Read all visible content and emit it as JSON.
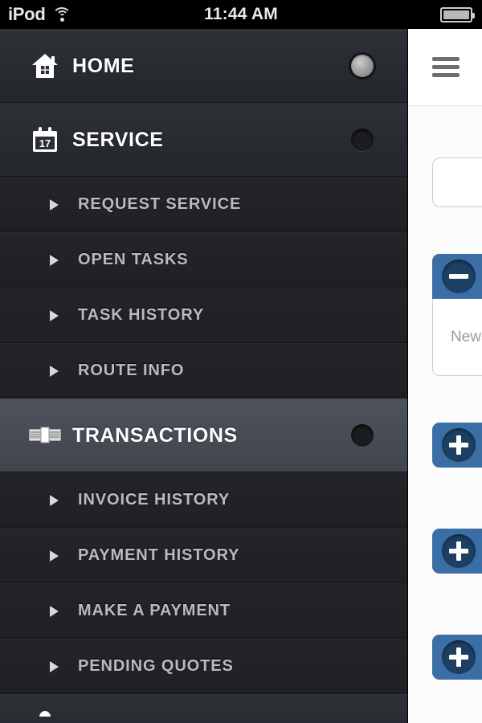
{
  "status_bar": {
    "carrier": "iPod",
    "wifi_icon": "wifi-icon",
    "time": "11:44 AM",
    "battery_icon": "battery-icon"
  },
  "sidebar": {
    "sections": [
      {
        "label": "HOME",
        "icon": "home-icon",
        "indicator": "on",
        "children": []
      },
      {
        "label": "SERVICE",
        "icon": "calendar-icon",
        "icon_day": "17",
        "indicator": "off",
        "children": [
          {
            "label": "REQUEST SERVICE",
            "icon": "triangle-right-icon"
          },
          {
            "label": "OPEN TASKS",
            "icon": "triangle-right-icon"
          },
          {
            "label": "TASK HISTORY",
            "icon": "triangle-right-icon"
          },
          {
            "label": "ROUTE INFO",
            "icon": "triangle-right-icon"
          }
        ]
      },
      {
        "label": "TRANSACTIONS",
        "icon": "money-stack-icon",
        "indicator": "off",
        "selected": true,
        "children": [
          {
            "label": "INVOICE HISTORY",
            "icon": "triangle-right-icon"
          },
          {
            "label": "PAYMENT HISTORY",
            "icon": "triangle-right-icon"
          },
          {
            "label": "MAKE A PAYMENT",
            "icon": "triangle-right-icon"
          },
          {
            "label": "PENDING QUOTES",
            "icon": "triangle-right-icon"
          }
        ]
      }
    ]
  },
  "content": {
    "menu_toggle_icon": "hamburger-icon",
    "panels": [
      {
        "toggle_icon": "minus-circle-icon",
        "title": "News",
        "expanded": true
      },
      {
        "toggle_icon": "plus-circle-icon",
        "title": "",
        "expanded": false
      },
      {
        "toggle_icon": "plus-circle-icon",
        "title": "",
        "expanded": false
      },
      {
        "toggle_icon": "plus-circle-icon",
        "title": "",
        "expanded": false
      }
    ]
  },
  "colors": {
    "menu_bg": "#2a2e33",
    "menu_sub_bg": "#222426",
    "menu_selected": "#474c53",
    "accent_blue": "#3a6ea5",
    "accent_blue_dark": "#1d3f63",
    "content_bg": "#fbfbfb"
  }
}
